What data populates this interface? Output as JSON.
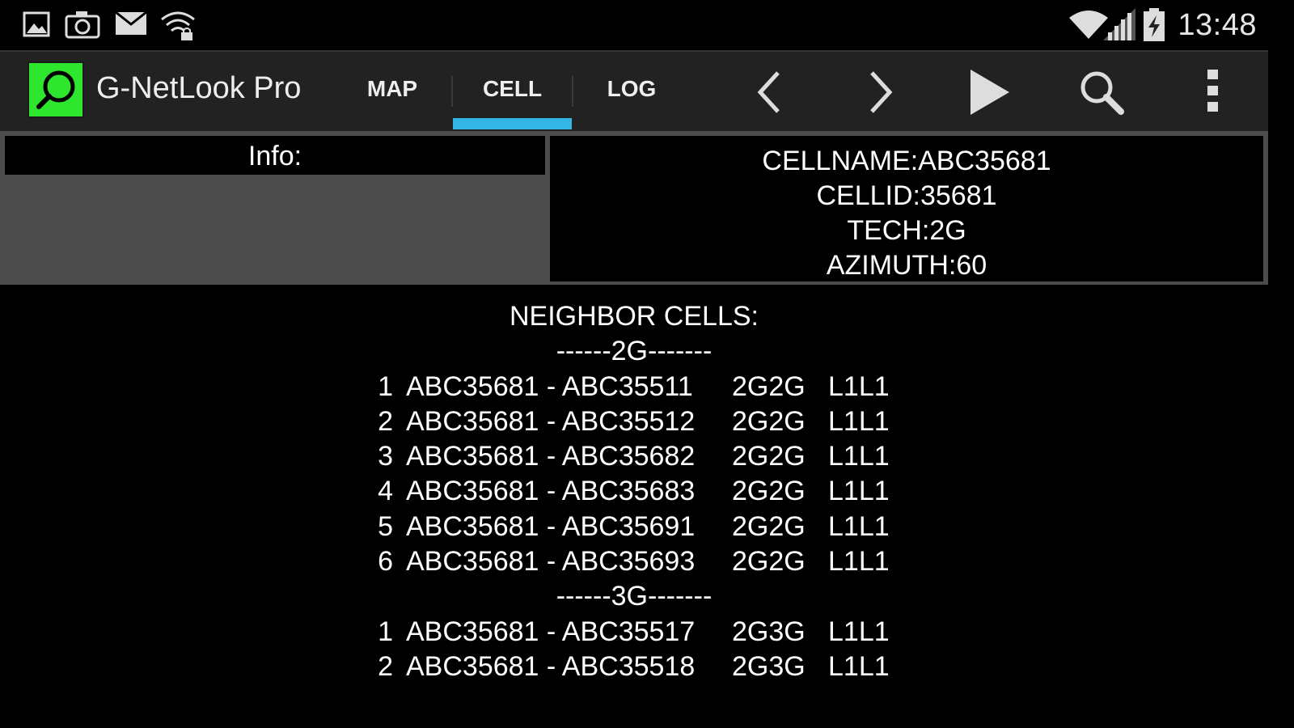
{
  "status_bar": {
    "time": "13:48",
    "left_icons": [
      "gallery-icon",
      "camera-icon",
      "mail-icon",
      "wifi-lock-icon"
    ],
    "right_icons": [
      "wifi-icon",
      "signal-icon",
      "battery-charging-icon"
    ]
  },
  "action_bar": {
    "app_title": "G-NetLook Pro",
    "tabs": [
      {
        "label": "MAP",
        "selected": false
      },
      {
        "label": "CELL",
        "selected": true
      },
      {
        "label": "LOG",
        "selected": false
      }
    ],
    "accent_color": "#33b5e5",
    "logo_color": "#2fe62f",
    "icons": [
      "chevron-left-icon",
      "chevron-right-icon",
      "play-icon",
      "search-icon",
      "overflow-menu-icon"
    ]
  },
  "info": {
    "header": "Info:",
    "cell_lines": [
      "CELLNAME:ABC35681",
      "CELLID:35681",
      "TECH:2G",
      "AZIMUTH:60"
    ]
  },
  "neighbors": {
    "title": "NEIGHBOR CELLS:",
    "groups": [
      {
        "header": "------2G-------",
        "rows": [
          {
            "num": "1",
            "pair": "ABC35681 - ABC35511",
            "tech": "2G2G",
            "layer": "L1L1"
          },
          {
            "num": "2",
            "pair": "ABC35681 - ABC35512",
            "tech": "2G2G",
            "layer": "L1L1"
          },
          {
            "num": "3",
            "pair": "ABC35681 - ABC35682",
            "tech": "2G2G",
            "layer": "L1L1"
          },
          {
            "num": "4",
            "pair": "ABC35681 - ABC35683",
            "tech": "2G2G",
            "layer": "L1L1"
          },
          {
            "num": "5",
            "pair": "ABC35681 - ABC35691",
            "tech": "2G2G",
            "layer": "L1L1"
          },
          {
            "num": "6",
            "pair": "ABC35681 - ABC35693",
            "tech": "2G2G",
            "layer": "L1L1"
          }
        ]
      },
      {
        "header": "------3G-------",
        "rows": [
          {
            "num": "1",
            "pair": "ABC35681 - ABC35517",
            "tech": "2G3G",
            "layer": "L1L1"
          },
          {
            "num": "2",
            "pair": "ABC35681 - ABC35518",
            "tech": "2G3G",
            "layer": "L1L1"
          }
        ]
      }
    ]
  }
}
